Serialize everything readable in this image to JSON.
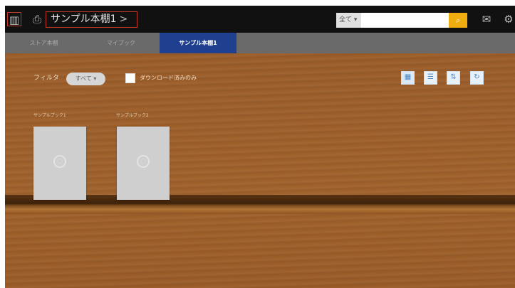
{
  "header": {
    "title": "サンプル本棚1",
    "chevron": ">",
    "search_select": "全て ▾",
    "search_placeholder": "",
    "search_button_icon": "search-icon"
  },
  "tabs": [
    {
      "label": "ストア本棚"
    },
    {
      "label": "マイブック"
    },
    {
      "label": "サンプル本棚1"
    }
  ],
  "toolbar": {
    "filter_label": "フィルタ",
    "filter_value": "すべて ▾",
    "download_only_label": "ダウンロード済みのみ"
  },
  "books": [
    {
      "title": "サンプルブック1"
    },
    {
      "title": "サンプルブック2"
    }
  ],
  "colors": {
    "accent": "#1f3f8f",
    "search_button": "#f0ad10",
    "highlight_border": "#c0392b"
  }
}
